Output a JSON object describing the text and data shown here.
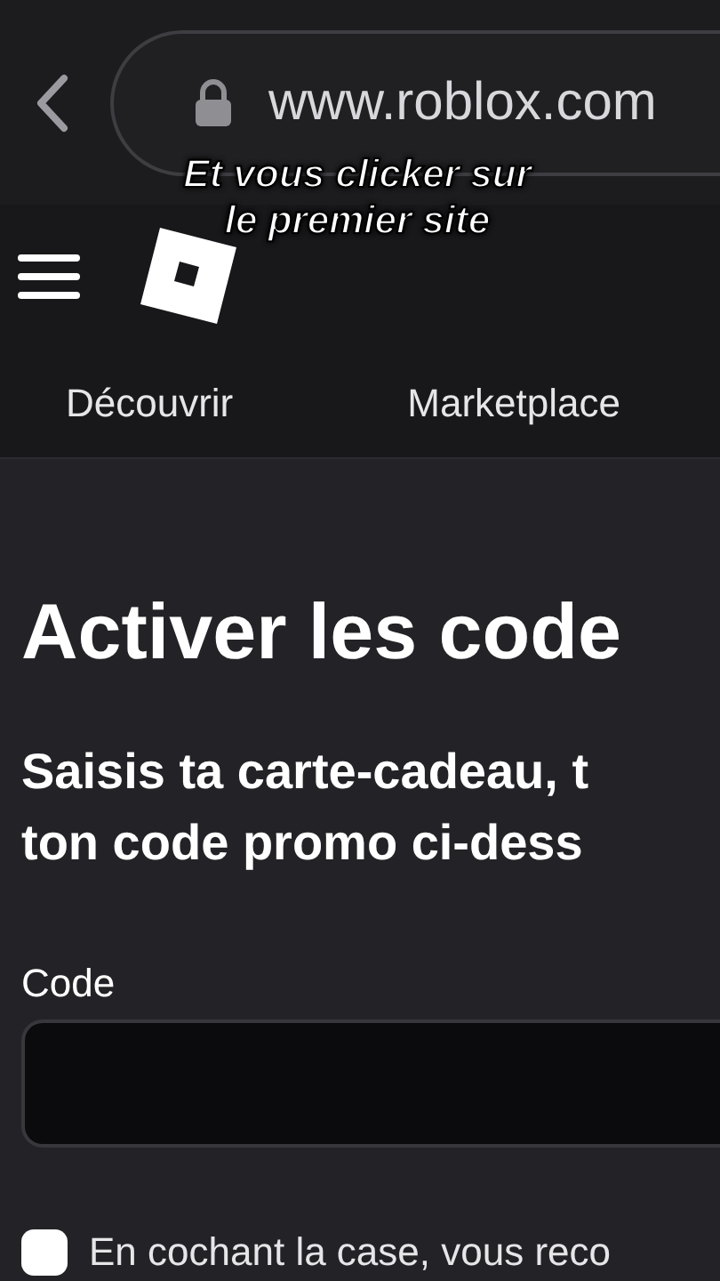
{
  "browser": {
    "url": "www.roblox.com"
  },
  "caption": [
    "Et vous clicker sur",
    "le premier site"
  ],
  "nav_tabs": [
    {
      "label": "Découvrir",
      "selected": false
    },
    {
      "label": "Marketplace",
      "selected": false
    }
  ],
  "page": {
    "title": "Activer les code",
    "subtitle": [
      "Saisis ta carte-cadeau, t",
      "ton code promo ci-dess"
    ]
  },
  "code_field": {
    "label": "Code"
  },
  "consent": {
    "checked": false,
    "text": "En cochant la case, vous reco"
  }
}
